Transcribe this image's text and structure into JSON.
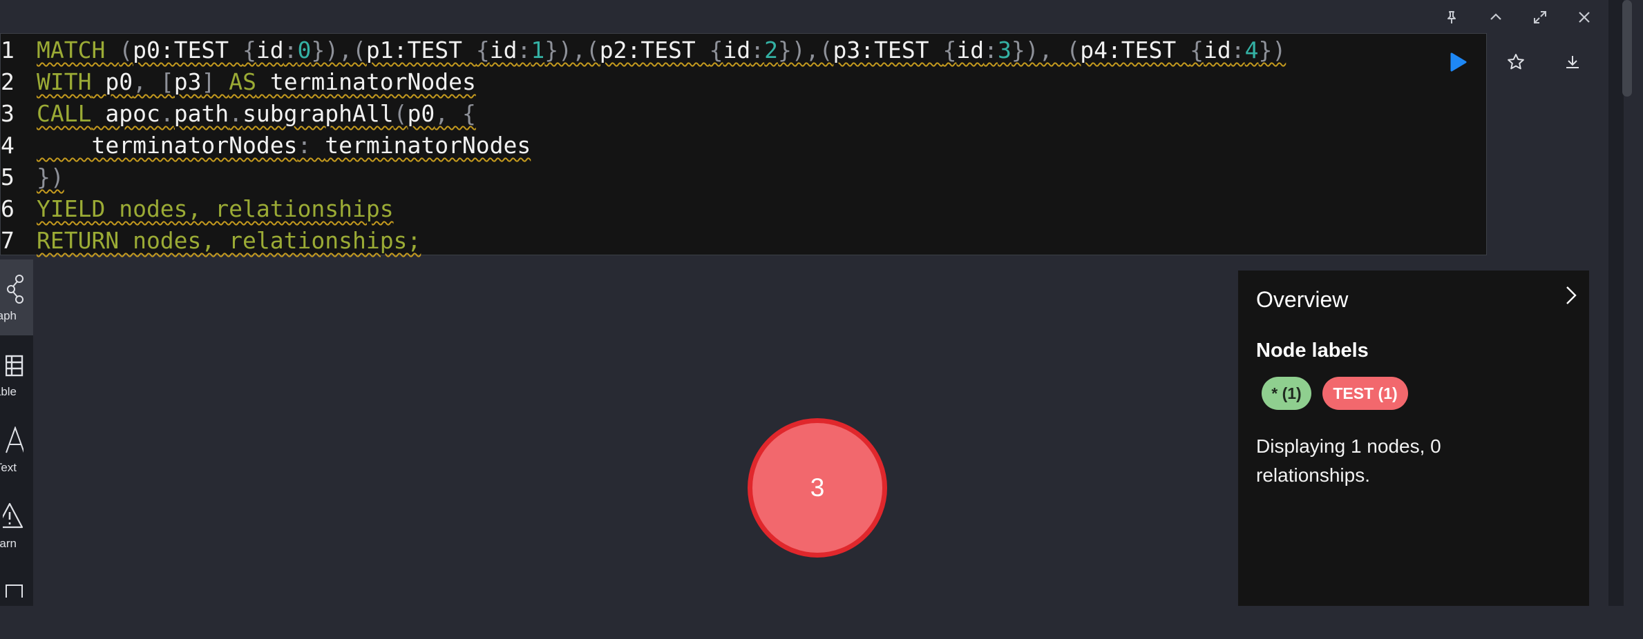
{
  "editor": {
    "lines": [
      {
        "n": "1",
        "tokens": [
          {
            "t": "MATCH",
            "c": "kw"
          },
          {
            "t": " ",
            "c": ""
          },
          {
            "t": "(",
            "c": "pun"
          },
          {
            "t": "p0:TEST ",
            "c": ""
          },
          {
            "t": "{",
            "c": "pun"
          },
          {
            "t": "id",
            "c": ""
          },
          {
            "t": ":",
            "c": "pun"
          },
          {
            "t": "0",
            "c": "num"
          },
          {
            "t": "}),(",
            "c": "pun"
          },
          {
            "t": "p1:TEST ",
            "c": ""
          },
          {
            "t": "{",
            "c": "pun"
          },
          {
            "t": "id",
            "c": ""
          },
          {
            "t": ":",
            "c": "pun"
          },
          {
            "t": "1",
            "c": "num"
          },
          {
            "t": "}),(",
            "c": "pun"
          },
          {
            "t": "p2:TEST ",
            "c": ""
          },
          {
            "t": "{",
            "c": "pun"
          },
          {
            "t": "id",
            "c": ""
          },
          {
            "t": ":",
            "c": "pun"
          },
          {
            "t": "2",
            "c": "num"
          },
          {
            "t": "}),(",
            "c": "pun"
          },
          {
            "t": "p3:TEST ",
            "c": ""
          },
          {
            "t": "{",
            "c": "pun"
          },
          {
            "t": "id",
            "c": ""
          },
          {
            "t": ":",
            "c": "pun"
          },
          {
            "t": "3",
            "c": "num"
          },
          {
            "t": "}), (",
            "c": "pun"
          },
          {
            "t": "p4:TEST ",
            "c": ""
          },
          {
            "t": "{",
            "c": "pun"
          },
          {
            "t": "id",
            "c": ""
          },
          {
            "t": ":",
            "c": "pun"
          },
          {
            "t": "4",
            "c": "num"
          },
          {
            "t": "})",
            "c": "pun"
          }
        ]
      },
      {
        "n": "2",
        "tokens": [
          {
            "t": "WITH",
            "c": "kw"
          },
          {
            "t": " p0",
            "c": ""
          },
          {
            "t": ", [",
            "c": "pun"
          },
          {
            "t": "p3",
            "c": ""
          },
          {
            "t": "] ",
            "c": "pun"
          },
          {
            "t": "AS",
            "c": "kw"
          },
          {
            "t": " terminatorNodes",
            "c": ""
          }
        ]
      },
      {
        "n": "3",
        "tokens": [
          {
            "t": "CALL",
            "c": "kw"
          },
          {
            "t": " apoc",
            "c": ""
          },
          {
            "t": ".",
            "c": "pun"
          },
          {
            "t": "path",
            "c": ""
          },
          {
            "t": ".",
            "c": "pun"
          },
          {
            "t": "subgraphAll",
            "c": ""
          },
          {
            "t": "(",
            "c": "pun"
          },
          {
            "t": "p0",
            "c": ""
          },
          {
            "t": ", {",
            "c": "pun"
          }
        ]
      },
      {
        "n": "4",
        "tokens": [
          {
            "t": "    terminatorNodes",
            "c": ""
          },
          {
            "t": ": ",
            "c": "pun"
          },
          {
            "t": "terminatorNodes",
            "c": ""
          }
        ]
      },
      {
        "n": "5",
        "tokens": [
          {
            "t": "})",
            "c": "pun"
          }
        ]
      },
      {
        "n": "6",
        "tokens": [
          {
            "t": "YIELD nodes, relationships",
            "c": "kw"
          }
        ]
      },
      {
        "n": "7",
        "tokens": [
          {
            "t": "RETURN nodes, relationships;",
            "c": "kw"
          }
        ]
      }
    ]
  },
  "sidenav": {
    "items": [
      {
        "label": "Graph",
        "icon": "graph-icon"
      },
      {
        "label": "Table",
        "icon": "table-icon"
      },
      {
        "label": "Text",
        "icon": "text-icon"
      },
      {
        "label": "Warn",
        "icon": "warning-icon"
      }
    ]
  },
  "graph": {
    "node": {
      "caption": "3",
      "fill": "#f2686d",
      "stroke": "#e0272c"
    }
  },
  "overview": {
    "title": "Overview",
    "node_labels_heading": "Node labels",
    "pills": [
      {
        "text": "* (1)",
        "bg": "#8fcf8f",
        "fg": "#1f2a1f"
      },
      {
        "text": "TEST (1)",
        "bg": "#f2686d",
        "fg": "#ffffff"
      }
    ],
    "summary": "Displaying 1 nodes, 0 relationships."
  },
  "colors": {
    "accent": "#1e88f5",
    "keyword": "#9bab35",
    "number": "#34b1a4"
  }
}
